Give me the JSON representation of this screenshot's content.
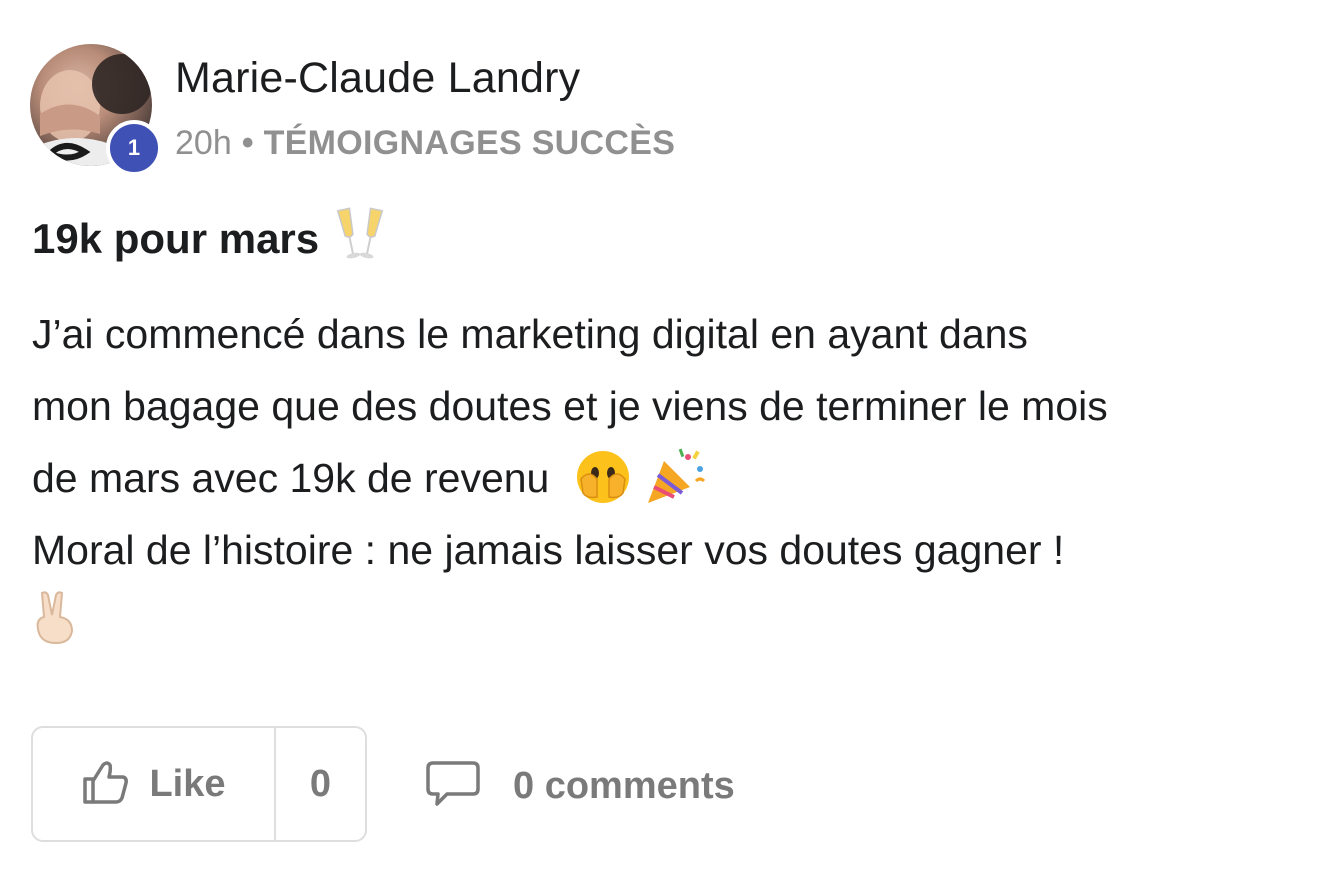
{
  "author": {
    "name": "Marie-Claude Landry",
    "level": "1"
  },
  "meta": {
    "time": "20h",
    "separator": "•",
    "category": "TÉMOIGNAGES SUCCÈS"
  },
  "post": {
    "title": "19k pour mars",
    "title_emoji": "clinking-glasses",
    "body_lines": [
      "J’ai commencé dans le marketing digital en ayant dans",
      "mon bagage que des doutes et je viens de terminer le mois",
      "de mars avec 19k de revenu",
      "Moral de l’histoire : ne jamais laisser vos doutes gagner !"
    ],
    "line3_emojis": [
      "face-with-hand-over-mouth",
      "party-popper"
    ],
    "end_emoji": "victory-hand"
  },
  "footer": {
    "like_label": "Like",
    "like_count": "0",
    "comments_label": "0 comments"
  },
  "colors": {
    "text": "#1c1d1f",
    "muted": "#909090",
    "footer_text": "#7a7a7a",
    "badge": "#3f51b5",
    "border": "#dedede"
  }
}
